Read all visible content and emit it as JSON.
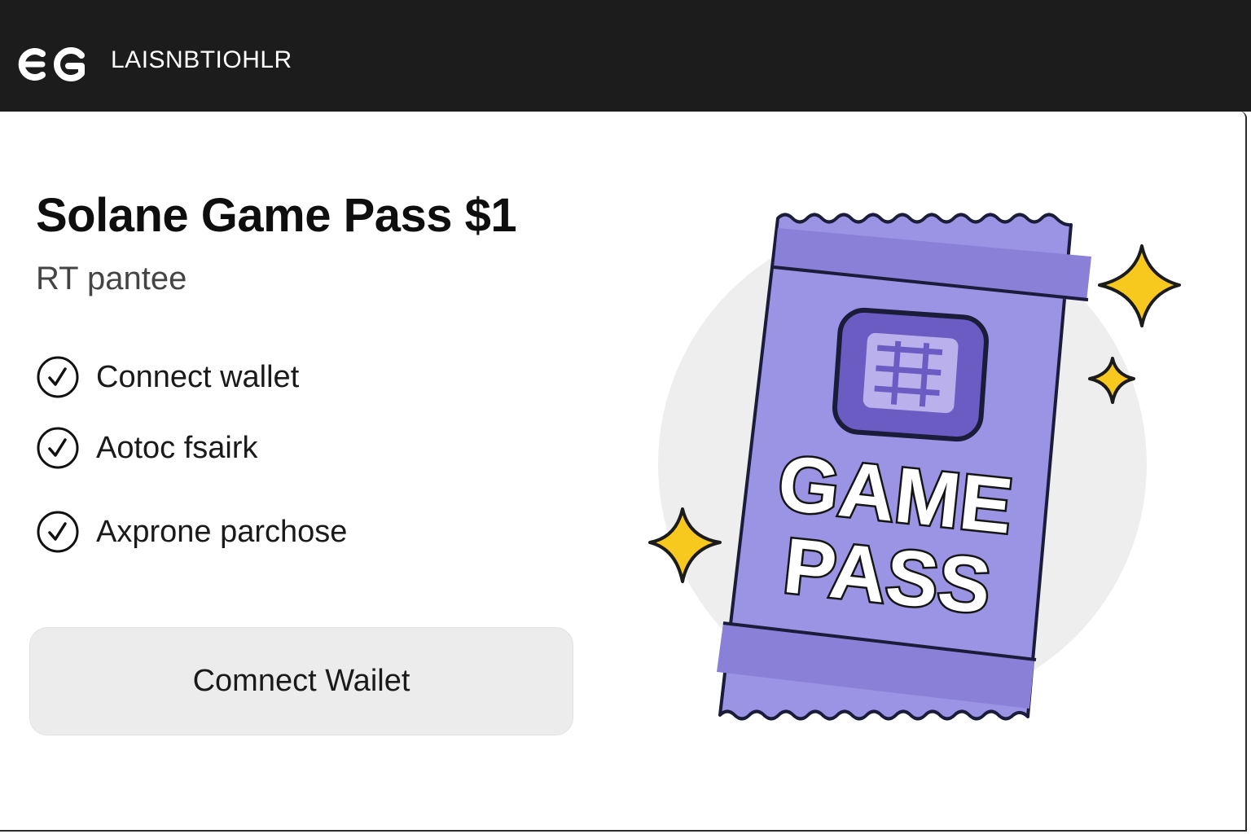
{
  "header": {
    "logo_icon": "eg-logo-icon",
    "brand_text": "LAISNBTIOHLR"
  },
  "main": {
    "title": "Solane Game Pass $1",
    "subtitle": "RT pantee",
    "steps": [
      {
        "label": "Connect wallet",
        "icon": "check-circle-icon"
      },
      {
        "label": "Aotoc fsairk",
        "icon": "check-circle-icon"
      },
      {
        "label": "Axprone parchose",
        "icon": "check-circle-icon"
      }
    ],
    "connect_button_label": "Comnect Wailet"
  },
  "illustration": {
    "pass_line1": "GAME",
    "pass_line2": "PASS",
    "icon": "game-pass-ticket-icon",
    "colors": {
      "ticket": "#9b93e4",
      "ticket_band": "#8a80d8",
      "badge": "#6b5cc4",
      "sparkle": "#f7c81e",
      "backdrop": "#eeeeee"
    }
  }
}
